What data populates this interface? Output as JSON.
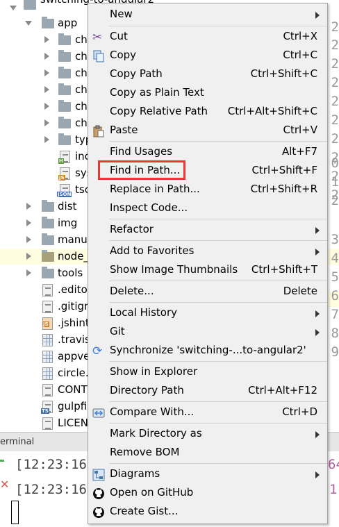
{
  "project_tree": {
    "root_label": "switching-to-angular2",
    "items": [
      {
        "label": "app",
        "type": "folder",
        "expanded": true
      },
      {
        "label": "ch",
        "type": "folder"
      },
      {
        "label": "ch",
        "type": "folder"
      },
      {
        "label": "ch",
        "type": "folder"
      },
      {
        "label": "ch",
        "type": "folder"
      },
      {
        "label": "ch",
        "type": "folder"
      },
      {
        "label": "ch",
        "type": "folder"
      },
      {
        "label": "typ",
        "type": "folder"
      },
      {
        "label": "inc",
        "type": "html"
      },
      {
        "label": "sys",
        "type": "js"
      },
      {
        "label": "tsc",
        "type": "json"
      },
      {
        "label": "dist",
        "type": "folder"
      },
      {
        "label": "img",
        "type": "folder"
      },
      {
        "label": "manua",
        "type": "folder"
      },
      {
        "label": "node_",
        "type": "folder"
      },
      {
        "label": "tools",
        "type": "folder"
      },
      {
        "label": ".edito",
        "type": "text"
      },
      {
        "label": ".gitigr",
        "type": "text"
      },
      {
        "label": ".jshint",
        "type": "js"
      },
      {
        "label": ".travis",
        "type": "grid"
      },
      {
        "label": "appve",
        "type": "grid"
      },
      {
        "label": "circle.",
        "type": "grid"
      },
      {
        "label": "CONT",
        "type": "text"
      },
      {
        "label": "gulpfil",
        "type": "ts"
      },
      {
        "label": "LICENS",
        "type": "text"
      }
    ],
    "badges": {
      "html": "H",
      "js": "JS",
      "json": "JSON",
      "ts": "TS"
    }
  },
  "gutter": {
    "numbers": [
      "2",
      "2",
      "2",
      "2",
      "2",
      "2",
      "2",
      "2",
      "2",
      "2",
      "0",
      "1",
      "2",
      "3",
      "4",
      "5",
      "6",
      "7",
      "8",
      "9"
    ]
  },
  "terminal": {
    "tab_label": "erminal",
    "lines": [
      "[12:23:16]",
      "[12:23:16]"
    ],
    "right_fragments": [
      "64",
      "1"
    ]
  },
  "context_menu": {
    "items": {
      "new": {
        "label": "New"
      },
      "cut": {
        "label": "Cut",
        "shortcut": "Ctrl+X"
      },
      "copy": {
        "label": "Copy",
        "shortcut": "Ctrl+C"
      },
      "copy_path": {
        "label": "Copy Path",
        "shortcut": "Ctrl+Shift+C"
      },
      "copy_plain": {
        "label": "Copy as Plain Text",
        "shortcut": ""
      },
      "copy_relative": {
        "label": "Copy Relative Path",
        "shortcut": "Ctrl+Alt+Shift+C"
      },
      "paste": {
        "label": "Paste",
        "shortcut": "Ctrl+V"
      },
      "find_usages": {
        "label": "Find Usages",
        "shortcut": "Alt+F7"
      },
      "find_in_path": {
        "label": "Find in Path...",
        "shortcut": "Ctrl+Shift+F"
      },
      "replace_in_path": {
        "label": "Replace in Path...",
        "shortcut": "Ctrl+Shift+R"
      },
      "inspect_code": {
        "label": "Inspect Code..."
      },
      "refactor": {
        "label": "Refactor"
      },
      "add_favorites": {
        "label": "Add to Favorites"
      },
      "show_thumbnails": {
        "label": "Show Image Thumbnails",
        "shortcut": "Ctrl+Shift+T"
      },
      "delete": {
        "label": "Delete...",
        "shortcut": "Delete"
      },
      "local_history": {
        "label": "Local History"
      },
      "git": {
        "label": "Git"
      },
      "synchronize": {
        "label": "Synchronize 'switching-...to-angular2'"
      },
      "show_explorer": {
        "label": "Show in Explorer"
      },
      "directory_path": {
        "label": "Directory Path",
        "shortcut": "Ctrl+Alt+F12"
      },
      "compare_with": {
        "label": "Compare With...",
        "shortcut": "Ctrl+D"
      },
      "mark_directory": {
        "label": "Mark Directory as"
      },
      "remove_bom": {
        "label": "Remove BOM"
      },
      "diagrams": {
        "label": "Diagrams"
      },
      "open_github": {
        "label": "Open on GitHub"
      },
      "create_gist": {
        "label": "Create Gist..."
      }
    },
    "highlighted_item": "find_in_path",
    "highlight_color": "#e53935"
  },
  "colors": {
    "menu_bg": "#f0f0f0",
    "row_highlight": "#fffde0",
    "folder_icon": "#9aa7b0"
  }
}
